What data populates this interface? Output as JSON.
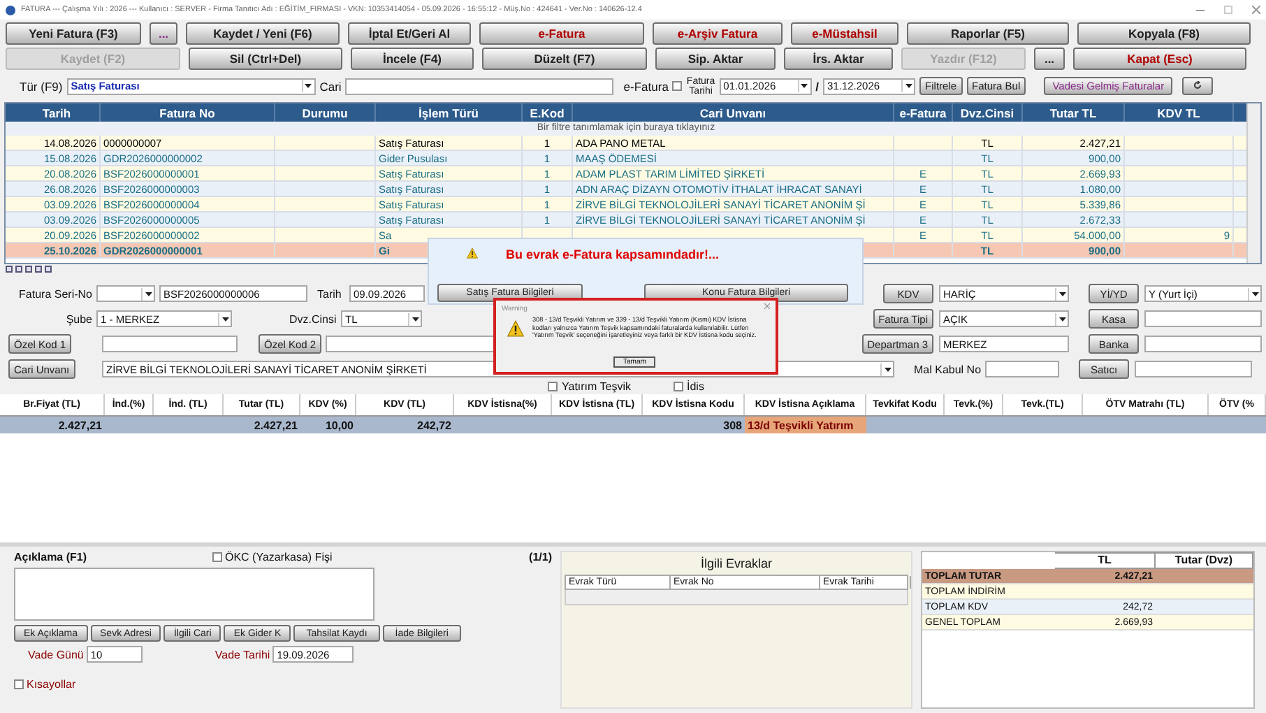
{
  "window": {
    "title": "FATURA  ---  Çalışma Yılı : 2026  ---  Kullanıcı : SERVER - Firma Tanıtıcı Adı : EĞİTİM_FIRMASI - VKN: 10353414054 - 05.09.2026 - 16:55:12 - Müş.No : 424641 - Ver.No : 140626-12.4"
  },
  "toolbar": {
    "row_1": [
      {
        "label": "Yeni Fatura (F3)",
        "kind": "normal"
      },
      {
        "label": "...",
        "kind": "purple"
      },
      {
        "label": "Kaydet / Yeni (F6)",
        "kind": "normal"
      },
      {
        "label": "İptal Et/Geri Al",
        "kind": "normal"
      },
      {
        "label": "e-Fatura",
        "kind": "red"
      },
      {
        "label": "e-Arşiv Fatura",
        "kind": "red"
      },
      {
        "label": "e-Müstahsil",
        "kind": "red"
      },
      {
        "label": "Raporlar (F5)",
        "kind": "normal"
      },
      {
        "label": "Kopyala (F8)",
        "kind": "normal"
      }
    ],
    "row_2": [
      {
        "label": "Kaydet (F2)",
        "kind": "disabled"
      },
      {
        "label": "Sil (Ctrl+Del)",
        "kind": "normal"
      },
      {
        "label": "İncele (F4)",
        "kind": "normal"
      },
      {
        "label": "Düzelt (F7)",
        "kind": "normal"
      },
      {
        "label": "Sip. Aktar",
        "kind": "normal"
      },
      {
        "label": "İrs. Aktar",
        "kind": "normal"
      },
      {
        "label": "Yazdır (F12)",
        "kind": "disabled"
      },
      {
        "label": "...",
        "kind": "normal"
      },
      {
        "label": "Kapat (Esc)",
        "kind": "red"
      }
    ]
  },
  "filter": {
    "type_label": "Tür (F9)",
    "type_value": "Satış Faturası",
    "cari_label": "Cari",
    "efatura": {
      "label": "e-Fatura",
      "checked": false
    },
    "date_label": [
      "Fatura",
      "Tarihi"
    ],
    "date_from": "01.01.2026",
    "date_separator": "/",
    "date_to": "31.12.2026",
    "buttons": [
      {
        "label": "Filtrele",
        "kind": "normal"
      },
      {
        "label": "Fatura Bul",
        "kind": "normal"
      },
      {
        "label": "Vadesi Gelmiş Faturalar",
        "kind": "purple"
      }
    ]
  },
  "invoice_table": {
    "columns": [
      "Tarih",
      "Fatura No",
      "Durumu",
      "İşlem Türü",
      "E.Kod",
      "Cari Unvanı",
      "e-Fatura",
      "Dvz.Cinsi",
      "Tutar TL",
      "KDV TL"
    ],
    "filter_hint": "Bir filtre tanımlamak için buraya tıklayınız",
    "rows": [
      {
        "cells": [
          "14.08.2026",
          "0000000007",
          "",
          "Satış Faturası",
          "1",
          "ADA PANO METAL",
          "",
          "TL",
          "2.427,21",
          ""
        ],
        "color": "#000000",
        "selected": false
      },
      {
        "cells": [
          "15.08.2026",
          "GDR2026000000002",
          "",
          "Gider Pusulası",
          "1",
          "MAAŞ ÖDEMESİ",
          "",
          "TL",
          "900,00",
          ""
        ],
        "color": "#1a6e86",
        "selected": false
      },
      {
        "cells": [
          "20.08.2026",
          "BSF2026000000001",
          "",
          "Satış Faturası",
          "1",
          "ADAM PLAST TARIM LİMİTED ŞİRKETİ",
          "E",
          "TL",
          "2.669,93",
          ""
        ],
        "color": "#1a6e86",
        "selected": false
      },
      {
        "cells": [
          "26.08.2026",
          "BSF2026000000003",
          "",
          "Satış Faturası",
          "1",
          "ADN ARAÇ DİZAYN OTOMOTİV İTHALAT İHRACAT SANAYİ",
          "E",
          "TL",
          "1.080,00",
          ""
        ],
        "color": "#1a6e86",
        "selected": false
      },
      {
        "cells": [
          "03.09.2026",
          "BSF2026000000004",
          "",
          "Satış Faturası",
          "1",
          "ZİRVE BİLGİ TEKNOLOJİLERİ SANAYİ TİCARET ANONİM Şİ",
          "E",
          "TL",
          "5.339,86",
          ""
        ],
        "color": "#1a6e86",
        "selected": false
      },
      {
        "cells": [
          "03.09.2026",
          "BSF2026000000005",
          "",
          "Satış Faturası",
          "1",
          "ZİRVE BİLGİ TEKNOLOJİLERİ SANAYİ TİCARET ANONİM Şİ",
          "E",
          "TL",
          "2.672,33",
          ""
        ],
        "color": "#1a6e86",
        "selected": false
      },
      {
        "cells": [
          "20.09.2026",
          "BSF2026000000002",
          "",
          "Sa",
          "",
          "",
          "E",
          "TL",
          "54.000,00",
          "9"
        ],
        "color": "#1a6e86",
        "selected": false
      },
      {
        "cells": [
          "25.10.2026",
          "GDR2026000000001",
          "",
          "Gi",
          "",
          "",
          "",
          "TL",
          "900,00",
          ""
        ],
        "color": "#1a6e86",
        "selected": true
      }
    ]
  },
  "popup": {
    "message": "Bu evrak e-Fatura kapsamındadır!...",
    "buttons": [
      "Satış Fatura Bilgileri",
      "Konu Fatura Bilgileri"
    ]
  },
  "warning": {
    "title": "Warning",
    "message": "308 - 13/d Teşvikli Yatırım ve 339 - 13/d Teşvikli Yatırım (Kısmi) KDV İstisna kodları yalnızca Yatırım Teşvik kapsamındaki faturalarda kullanılabilir. Lütfen 'Yatırım Teşvik' seçeneğini işaretleyiniz veya farklı bir KDV İstisna kodu seçiniz.",
    "button": "Tamam"
  },
  "form": {
    "seri_no": {
      "label": "Fatura Seri-No",
      "value": "BSF2026000000006"
    },
    "tarih": {
      "label": "Tarih",
      "value": "09.09.2026"
    },
    "sube": {
      "label": "Şube",
      "value": "1 - MERKEZ"
    },
    "doviz": {
      "label": "Dvz.Cinsi",
      "value": "TL"
    },
    "ozel_kod_1": "Özel Kod 1",
    "ozel_kod_2": "Özel Kod 2",
    "cari_unvani": {
      "button": "Cari Unvanı",
      "value": "ZİRVE BİLGİ TEKNOLOJİLERİ SANAYİ TİCARET ANONİM ŞİRKETİ"
    },
    "mal_kabul_no": "Mal Kabul No",
    "kdv": {
      "button": "KDV",
      "value": "HARİÇ"
    },
    "yi_yd": {
      "button": "Yİ/YD",
      "value": "Y (Yurt İçi)"
    },
    "fatura_tipi": {
      "button": "Fatura Tipi",
      "value": "AÇIK"
    },
    "kasa": "Kasa",
    "departman": {
      "button": "Departman 3",
      "value": "MERKEZ"
    },
    "banka": "Banka",
    "satici": "Satıcı",
    "options": [
      {
        "label": "Yatırım Teşvik",
        "checked": false
      },
      {
        "label": "İdis",
        "checked": false
      }
    ]
  },
  "lines_table": {
    "columns": [
      "Br.Fiyat (TL)",
      "İnd.(%)",
      "İnd. (TL)",
      "Tutar (TL)",
      "KDV (%)",
      "KDV (TL)",
      "KDV İstisna(%)",
      "KDV İstisna (TL)",
      "KDV İstisna Kodu",
      "KDV İstisna Açıklama",
      "Tevkifat Kodu",
      "Tevk.(%)",
      "Tevk.(TL)",
      "ÖTV Matrahı (TL)",
      "ÖTV (%"
    ],
    "rows": [
      {
        "cells": [
          {
            "text": "2.427,21",
            "kind": "value"
          },
          {
            "text": "",
            "kind": "value"
          },
          {
            "text": "",
            "kind": "value"
          },
          {
            "text": "2.427,21",
            "kind": "value"
          },
          {
            "text": "10,00",
            "kind": "value"
          },
          {
            "text": "242,72",
            "kind": "value"
          },
          {
            "text": "",
            "kind": "value"
          },
          {
            "text": "",
            "kind": "value"
          },
          {
            "text": "308",
            "kind": "value"
          },
          {
            "text": "13/d Teşvikli Yatırım",
            "kind": "note"
          },
          {
            "text": "",
            "kind": "value"
          },
          {
            "text": "",
            "kind": "value"
          },
          {
            "text": "",
            "kind": "value"
          },
          {
            "text": "",
            "kind": "value"
          },
          {
            "text": "",
            "kind": "value"
          }
        ]
      }
    ]
  },
  "notes": {
    "label": "Açıklama (F1)",
    "okc": {
      "label": "ÖKC (Yazarkasa) Fişi",
      "checked": false
    },
    "page": "(1/1)",
    "buttons": [
      "Ek Açıklama",
      "Sevk Adresi",
      "İlgili Cari",
      "Ek Gider K",
      "Tahsilat Kaydı",
      "İade Bilgileri"
    ],
    "vade_gunu": {
      "label": "Vade Günü",
      "value": "10"
    },
    "vade_tarihi": {
      "label": "Vade Tarihi",
      "value": "19.09.2026"
    },
    "shortcuts": {
      "label": "Kısayollar",
      "checked": false
    }
  },
  "related": {
    "title": "İlgili Evraklar",
    "columns": [
      "Evrak Türü",
      "Evrak No",
      "Evrak Tarihi"
    ]
  },
  "totals": {
    "columns": [
      "TL",
      "Tutar (Dvz)"
    ],
    "rows": [
      {
        "label": "TOPLAM TUTAR",
        "tl": "2.427,21",
        "kind": "total"
      },
      {
        "label": "TOPLAM İNDİRİM",
        "tl": "",
        "kind": "plain"
      },
      {
        "label": "TOPLAM KDV",
        "tl": "242,72",
        "kind": "plain"
      },
      {
        "label": "GENEL TOPLAM",
        "tl": "2.669,93",
        "kind": "plain"
      }
    ]
  }
}
